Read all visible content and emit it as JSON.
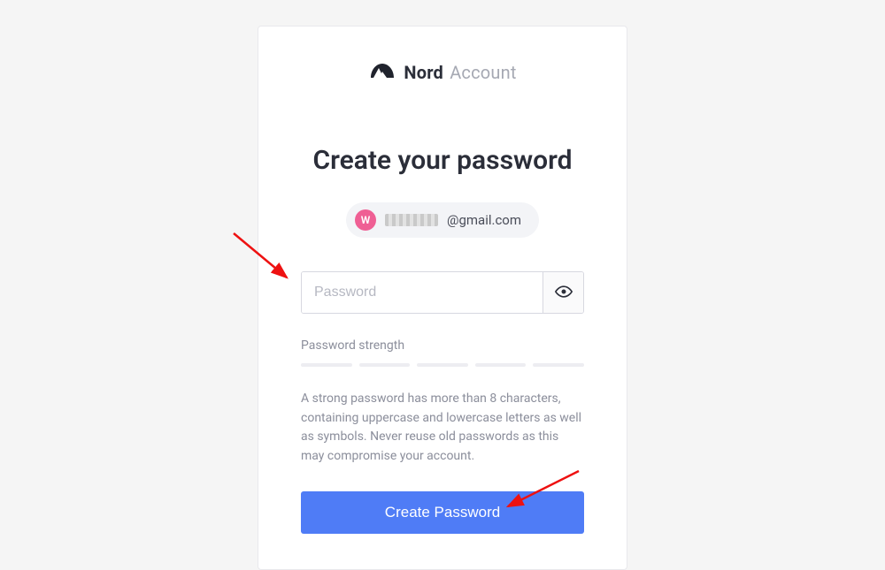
{
  "brand": {
    "nord": "Nord",
    "account": "Account"
  },
  "title": "Create your password",
  "email": {
    "avatar_initial": "W",
    "domain": "@gmail.com"
  },
  "password_field": {
    "placeholder": "Password",
    "value": ""
  },
  "strength": {
    "label": "Password strength"
  },
  "hint": "A strong password has more than 8 characters, containing uppercase and lowercase letters as well as symbols. Never reuse old passwords as this may compromise your account.",
  "submit_label": "Create Password"
}
